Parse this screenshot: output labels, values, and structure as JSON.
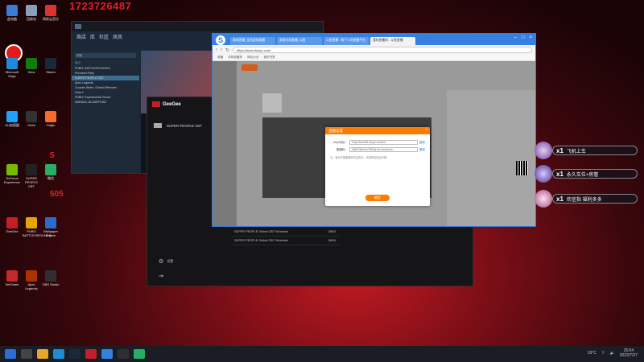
{
  "desktop": {
    "watermark_number": "1723726487",
    "red_labels": [
      "5",
      "505"
    ],
    "icons": [
      {
        "label": "此电脑",
        "color": "#3a7bd5"
      },
      {
        "label": "回收站",
        "color": "#8aa0b8"
      },
      {
        "label": "网易云音乐",
        "color": "#d33"
      },
      {
        "label": "Microsoft Edge",
        "color": "#1f8ad6"
      },
      {
        "label": "Xbox",
        "color": "#107c10"
      },
      {
        "label": "Steam",
        "color": "#1b2838"
      },
      {
        "label": "UU加速器",
        "color": "#1fa1ff"
      },
      {
        "label": "Geek",
        "color": "#333"
      },
      {
        "label": "Origin",
        "color": "#f56c2d"
      },
      {
        "label": "GeForce Experience",
        "color": "#76b900"
      },
      {
        "label": "SUPER PEOPLE CBT",
        "color": "#222"
      },
      {
        "label": "微信",
        "color": "#2aae67"
      },
      {
        "label": "GeeGee",
        "color": "#c41e2a"
      },
      {
        "label": "PUBG BATTLEGROUNDS",
        "color": "#e6a400"
      },
      {
        "label": "Wallpaper Engine",
        "color": "#2a6bcc"
      },
      {
        "label": "WeGame",
        "color": "#c12a2a"
      },
      {
        "label": "Apex Legends",
        "color": "#a30"
      },
      {
        "label": "OBS Studio",
        "color": "#302e31"
      }
    ]
  },
  "steam": {
    "nav": [
      "商店",
      "库",
      "社区",
      "凤凤"
    ],
    "search_placeholder": "搜索",
    "section_recent": "最近",
    "games": [
      "PUBG: BATTLEGROUNDS",
      "Purrseed Party",
      "SUPER PEOPLE CBT",
      "Apex Legends",
      "Counter-Strike: Global Offensive",
      "Dota 2",
      "PUBG: Experimental Server",
      "NARAKA: BLADEPOINT"
    ]
  },
  "launcher": {
    "brand": "GeeGee",
    "game_title": "SUPER PEOPLE CBT",
    "settings_label": "设置",
    "news": [
      {
        "text": "SUPER PEOPLE Global CBT Schedule",
        "date": "08/04"
      },
      {
        "text": "SUPER PEOPLE Global CBT Schedule",
        "date": "08/04"
      }
    ]
  },
  "browser": {
    "tabs": [
      {
        "title": "游戏直播_全民游戏直播",
        "active": false
      },
      {
        "title": "游戏分类直播_斗鱼",
        "active": false
      },
      {
        "title": "斗鱼直播 - 每个人的直播平台",
        "active": false
      },
      {
        "title": "我的直播间 - 斗鱼直播",
        "active": true
      }
    ],
    "url": "https://www.douyu.com/",
    "bookmarks": [
      "收藏",
      "手机收藏夹",
      "网址大全",
      "我的书签"
    ],
    "dialog": {
      "title": "直播设置",
      "close": "×",
      "rtmp_label": "rtmp地址：",
      "rtmp_value": "rtmp://sendtc3.douyu.com/live",
      "rtmp_copy": "复制",
      "code_label": "直播码：",
      "code_value": "4668136rXKcCB9VgU4z?wsSecret=",
      "code_copy": "复制",
      "hint": "注：每次开播直播码均会变化，请重新复制后开播",
      "button": "确定"
    },
    "video_notice": "主播正在设置中，请稍候..."
  },
  "overlay": {
    "badges": [
      {
        "count": "x1",
        "text": "飞机上车"
      },
      {
        "count": "x1",
        "text": "永久车位+房管"
      },
      {
        "count": "x1",
        "text": "欢信指 福利多多"
      }
    ]
  },
  "taskbar": {
    "weather": "19°C",
    "time": "15:04",
    "date": "2022/7/27"
  }
}
